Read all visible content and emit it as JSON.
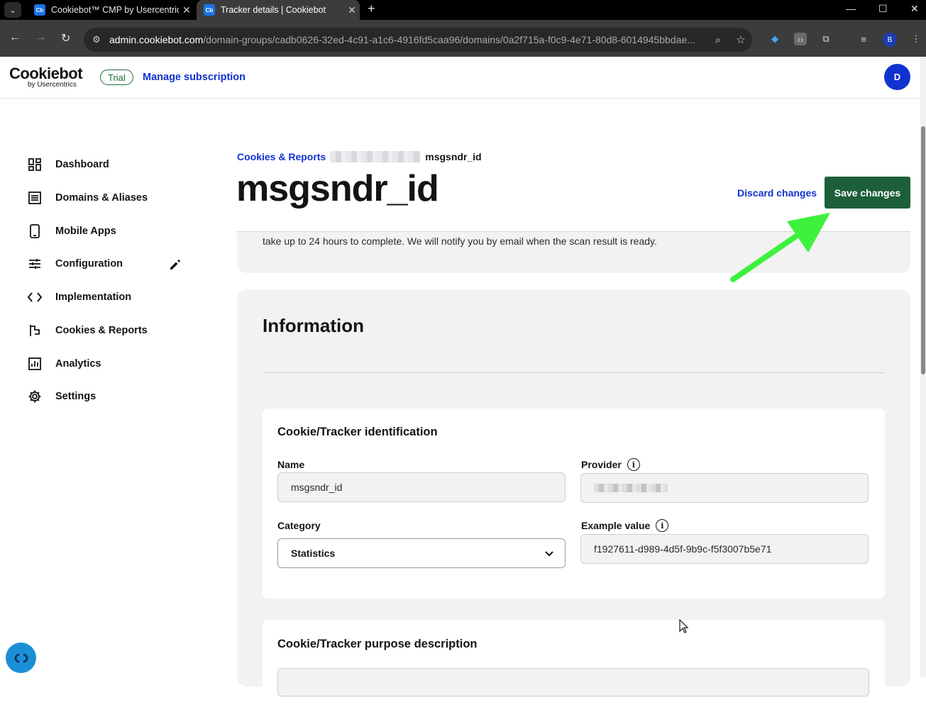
{
  "browser": {
    "tabs": [
      {
        "title": "Cookiebot™ CMP by Usercentrics",
        "active": false
      },
      {
        "title": "Tracker details | Cookiebot",
        "active": true
      }
    ],
    "url_host": "admin.cookiebot.com",
    "url_path": "/domain-groups/cadb0626-32ed-4c91-a1c6-4916fd5caa96/domains/0a2f715a-f0c9-4e71-80d8-6014945bbdae...",
    "profile_initial": "B"
  },
  "header": {
    "logo_main": "Cookiebot",
    "logo_sub": "by Usercentrics",
    "trial_badge": "Trial",
    "manage_link": "Manage subscription",
    "avatar_initial": "D"
  },
  "sidebar": {
    "items": [
      {
        "label": "Dashboard",
        "icon": "dashboard-icon"
      },
      {
        "label": "Domains & Aliases",
        "icon": "list-icon"
      },
      {
        "label": "Mobile Apps",
        "icon": "phone-icon"
      },
      {
        "label": "Configuration",
        "icon": "sliders-icon"
      },
      {
        "label": "Implementation",
        "icon": "code-icon"
      },
      {
        "label": "Cookies & Reports",
        "icon": "flag-icon"
      },
      {
        "label": "Analytics",
        "icon": "chart-icon"
      },
      {
        "label": "Settings",
        "icon": "gear-icon"
      }
    ]
  },
  "main": {
    "breadcrumb_link": "Cookies & Reports",
    "breadcrumb_current": "msgsndr_id",
    "title": "msgsndr_id",
    "discard_label": "Discard changes",
    "save_label": "Save changes",
    "notice_text": "take up to 24 hours to complete. We will notify you by email when the scan result is ready.",
    "info_heading": "Information",
    "identification": {
      "heading": "Cookie/Tracker identification",
      "name_label": "Name",
      "name_value": "msgsndr_id",
      "provider_label": "Provider",
      "category_label": "Category",
      "category_value": "Statistics",
      "example_label": "Example value",
      "example_value": "f1927611-d989-4d5f-9b9c-f5f3007b5e71"
    },
    "purpose": {
      "heading": "Cookie/Tracker purpose description"
    }
  },
  "colors": {
    "brand_blue": "#1032cf",
    "save_green": "#1d5f39",
    "annotation_arrow": "#3df13d"
  }
}
